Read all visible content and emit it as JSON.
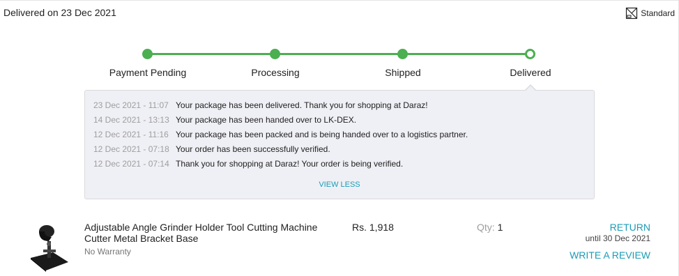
{
  "header": {
    "delivered_text": "Delivered on 23 Dec 2021",
    "shipping_type": "Standard",
    "shipping_icon": "box-truck-icon"
  },
  "progress": {
    "steps": [
      {
        "label": "Payment Pending",
        "state": "done"
      },
      {
        "label": "Processing",
        "state": "done"
      },
      {
        "label": "Shipped",
        "state": "done"
      },
      {
        "label": "Delivered",
        "state": "current"
      }
    ],
    "active_color": "#4caf50"
  },
  "timeline": {
    "events": [
      {
        "time": "23 Dec 2021 - 11:07",
        "message": "Your package has been delivered. Thank you for shopping at Daraz!"
      },
      {
        "time": "14 Dec 2021 - 13:13",
        "message": "Your package has been handed over to LK-DEX."
      },
      {
        "time": "12 Dec 2021 - 11:16",
        "message": "Your package has been packed and is being handed over to a logistics partner."
      },
      {
        "time": "12 Dec 2021 - 07:18",
        "message": "Your order has been successfully verified."
      },
      {
        "time": "12 Dec 2021 - 07:14",
        "message": "Thank you for shopping at Daraz! Your order is being verified."
      }
    ],
    "view_less_label": "VIEW LESS"
  },
  "item": {
    "name": "Adjustable Angle Grinder Holder Tool Cutting Machine Cutter Metal Bracket Base",
    "warranty": "No Warranty",
    "price": "Rs. 1,918",
    "qty_label": "Qty:",
    "qty_value": "1",
    "return_label": "RETURN",
    "return_until": "until 30 Dec 2021",
    "review_label": "WRITE A REVIEW",
    "link_color": "#1a9cb7"
  }
}
